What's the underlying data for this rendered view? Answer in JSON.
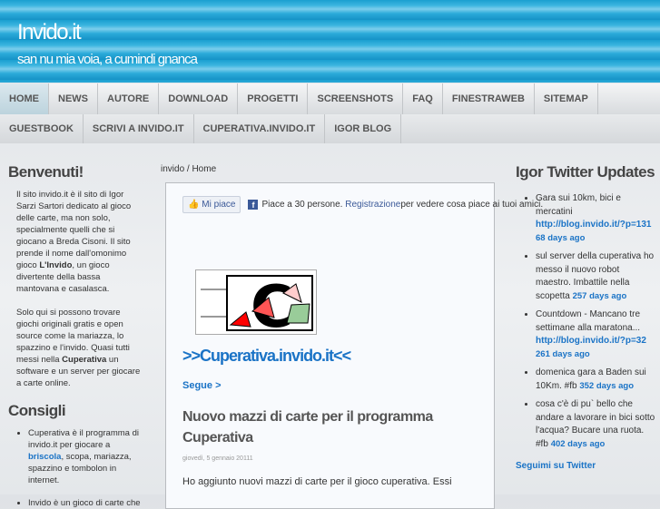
{
  "header": {
    "title": "Invido.it",
    "tagline": "san nu mia voia, a cumindi gnanca"
  },
  "nav": [
    "HOME",
    "NEWS",
    "AUTORE",
    "DOWNLOAD",
    "PROGETTI",
    "SCREENSHOTS",
    "FAQ",
    "FINESTRAWEB",
    "SITEMAP"
  ],
  "nav2": [
    "GUESTBOOK",
    "SCRIVI A INVIDO.IT",
    "CUPERATIVA.INVIDO.IT",
    "IGOR BLOG"
  ],
  "left": {
    "welcome_title": "Benvenuti!",
    "p1a": "Il sito invido.it è il sito di Igor Sarzi Sartori dedicato al gioco delle carte, ma non solo, specialmente quelli che si giocano a Breda Cisoni. Il sito prende il nome dall'omonimo gioco ",
    "p1b": "L'Invido",
    "p1c": ", un gioco divertente della bassa mantovana e casalasca.",
    "p2a": "Solo qui si possono trovare giochi originali gratis e open source come la mariazza, lo spazzino e l'invido. Quasi tutti messi nella ",
    "p2b": "Cuperativa",
    "p2c": " un software e un server per giocare a carte online.",
    "tips_title": "Consigli",
    "tip1a": "Cuperativa è il programma di invido.it per giocare a ",
    "tip1link": "briscola",
    "tip1b": ", scopa, mariazza, spazzino e tombolon in internet.",
    "tip2": "Invido è un gioco di carte che"
  },
  "main": {
    "breadcrumb": "invido / Home",
    "fb_like": "Mi piace",
    "fb_text": "Piace a 30 persone.",
    "fb_register": "Registrazione",
    "fb_text2": " per vedere cosa piace ai tuoi amici.",
    "post_title": ">>Cuperativa.invido.it<<",
    "more": "Segue >",
    "article_title": "Nuovo mazzi di carte per il programma Cuperativa",
    "date": "giovedì, 5 gennaio 20111",
    "body": "Ho aggiunto nuovi mazzi di carte per il gioco cuperativa. Essi"
  },
  "twitter": {
    "title": "Igor Twitter Updates",
    "items": [
      {
        "text": "Gara sui 10km, bici e mercatini ",
        "link": "http://blog.invido.it/?p=131",
        "ago": "68 days ago"
      },
      {
        "text": "sul server della cuperativa ho messo il nuovo robot maestro. Imbattile nella scopetta ",
        "link": "",
        "ago": "257 days ago"
      },
      {
        "text": "Countdown - Mancano tre settimane alla maratona... ",
        "link": "http://blog.invido.it/?p=32",
        "ago": "261 days ago"
      },
      {
        "text": "domenica gara a Baden sui 10Km. #fb ",
        "link": "",
        "ago": "352 days ago"
      },
      {
        "text": "cosa c'è di pu` bello che andare a lavorare in bici sotto l'acqua? Bucare una ruota. #fb ",
        "link": "",
        "ago": "402 days ago"
      }
    ],
    "follow": "Seguimi su Twitter"
  }
}
